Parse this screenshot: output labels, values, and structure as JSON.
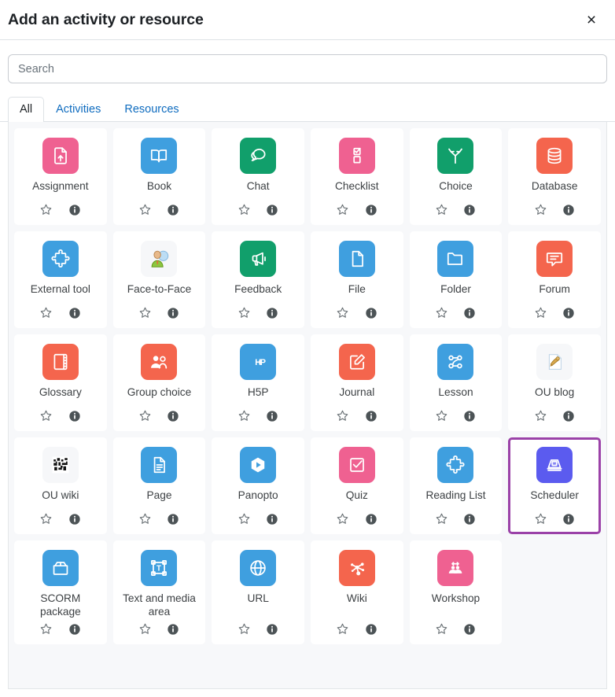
{
  "header": {
    "title": "Add an activity or resource",
    "close_label": "×",
    "close_icon": "close-icon"
  },
  "search": {
    "placeholder": "Search",
    "value": ""
  },
  "tabs": [
    {
      "label": "All",
      "active": true
    },
    {
      "label": "Activities",
      "active": false
    },
    {
      "label": "Resources",
      "active": false
    }
  ],
  "card_actions": {
    "star_icon": "star-outline-icon",
    "star_label": "Add to favourites",
    "info_icon": "info-circle-icon",
    "info_label": "Help with"
  },
  "colors": {
    "pink": "#ef6191",
    "blue": "#3f9fdf",
    "green": "#119f6b",
    "orange": "#f4654d",
    "indigo": "#5b5bef",
    "legacy_tile": "#f6f7f9",
    "highlight_border": "#9b42a8",
    "grid_background": "#f7f8fa",
    "tab_link": "#0f6cbf"
  },
  "activities": [
    {
      "label": "Assignment",
      "icon": "assignment-icon",
      "color": "pink"
    },
    {
      "label": "Book",
      "icon": "book-icon",
      "color": "blue"
    },
    {
      "label": "Chat",
      "icon": "chat-icon",
      "color": "green"
    },
    {
      "label": "Checklist",
      "icon": "checklist-icon",
      "color": "pink"
    },
    {
      "label": "Choice",
      "icon": "choice-icon",
      "color": "green"
    },
    {
      "label": "Database",
      "icon": "database-icon",
      "color": "orange"
    },
    {
      "label": "External tool",
      "icon": "external-tool-icon",
      "color": "blue"
    },
    {
      "label": "Face-to-Face",
      "icon": "face-to-face-icon",
      "color": "legacy"
    },
    {
      "label": "Feedback",
      "icon": "feedback-icon",
      "color": "green"
    },
    {
      "label": "File",
      "icon": "file-icon",
      "color": "blue"
    },
    {
      "label": "Folder",
      "icon": "folder-icon",
      "color": "blue"
    },
    {
      "label": "Forum",
      "icon": "forum-icon",
      "color": "orange"
    },
    {
      "label": "Glossary",
      "icon": "glossary-icon",
      "color": "orange"
    },
    {
      "label": "Group choice",
      "icon": "group-choice-icon",
      "color": "orange"
    },
    {
      "label": "H5P",
      "icon": "h5p-icon",
      "color": "blue"
    },
    {
      "label": "Journal",
      "icon": "journal-icon",
      "color": "orange"
    },
    {
      "label": "Lesson",
      "icon": "lesson-icon",
      "color": "blue"
    },
    {
      "label": "OU blog",
      "icon": "ou-blog-icon",
      "color": "legacy"
    },
    {
      "label": "OU wiki",
      "icon": "ou-wiki-icon",
      "color": "legacy"
    },
    {
      "label": "Page",
      "icon": "page-icon",
      "color": "blue"
    },
    {
      "label": "Panopto",
      "icon": "panopto-icon",
      "color": "blue"
    },
    {
      "label": "Quiz",
      "icon": "quiz-icon",
      "color": "pink"
    },
    {
      "label": "Reading List",
      "icon": "reading-list-icon",
      "color": "blue"
    },
    {
      "label": "Scheduler",
      "icon": "scheduler-icon",
      "color": "indigo",
      "highlighted": true
    },
    {
      "label": "SCORM package",
      "icon": "scorm-package-icon",
      "color": "blue"
    },
    {
      "label": "Text and media area",
      "icon": "text-media-area-icon",
      "color": "blue"
    },
    {
      "label": "URL",
      "icon": "url-icon",
      "color": "blue"
    },
    {
      "label": "Wiki",
      "icon": "wiki-icon",
      "color": "orange"
    },
    {
      "label": "Workshop",
      "icon": "workshop-icon",
      "color": "pink"
    }
  ]
}
